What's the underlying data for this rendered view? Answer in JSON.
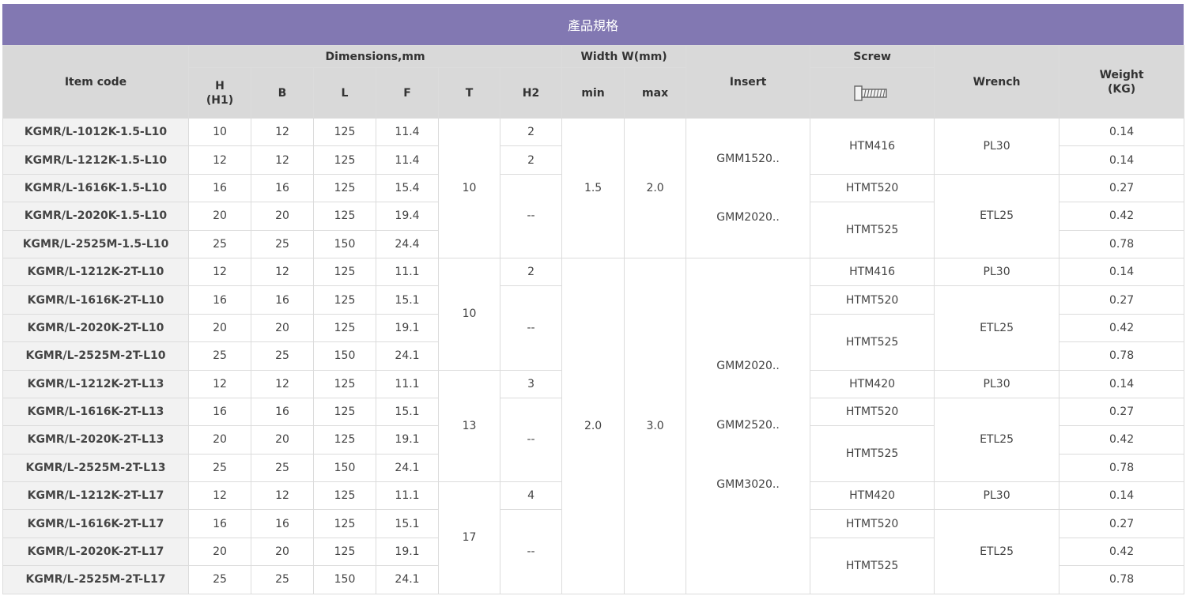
{
  "title": "產品規格",
  "headers": {
    "item_code": "Item code",
    "dimensions": "Dimensions,mm",
    "width": "Width W(mm)",
    "insert": "Insert",
    "screw": "Screw",
    "wrench": "Wrench",
    "weight_line1": "Weight",
    "weight_line2": "(KG)",
    "h_line1": "H",
    "h_line2": "(H1)",
    "b": "B",
    "l": "L",
    "f": "F",
    "t": "T",
    "h2": "H2",
    "min": "min",
    "max": "max",
    "screw_icon": "screw-icon"
  },
  "rows": [
    {
      "code": "KGMR/L-1012K-1.5-L10",
      "h": "10",
      "b": "12",
      "l": "125",
      "f": "11.4",
      "weight": "0.14"
    },
    {
      "code": "KGMR/L-1212K-1.5-L10",
      "h": "12",
      "b": "12",
      "l": "125",
      "f": "11.4",
      "weight": "0.14"
    },
    {
      "code": "KGMR/L-1616K-1.5-L10",
      "h": "16",
      "b": "16",
      "l": "125",
      "f": "15.4",
      "weight": "0.27"
    },
    {
      "code": "KGMR/L-2020K-1.5-L10",
      "h": "20",
      "b": "20",
      "l": "125",
      "f": "19.4",
      "weight": "0.42"
    },
    {
      "code": "KGMR/L-2525M-1.5-L10",
      "h": "25",
      "b": "25",
      "l": "150",
      "f": "24.4",
      "weight": "0.78"
    },
    {
      "code": "KGMR/L-1212K-2T-L10",
      "h": "12",
      "b": "12",
      "l": "125",
      "f": "11.1",
      "weight": "0.14"
    },
    {
      "code": "KGMR/L-1616K-2T-L10",
      "h": "16",
      "b": "16",
      "l": "125",
      "f": "15.1",
      "weight": "0.27"
    },
    {
      "code": "KGMR/L-2020K-2T-L10",
      "h": "20",
      "b": "20",
      "l": "125",
      "f": "19.1",
      "weight": "0.42"
    },
    {
      "code": "KGMR/L-2525M-2T-L10",
      "h": "25",
      "b": "25",
      "l": "150",
      "f": "24.1",
      "weight": "0.78"
    },
    {
      "code": "KGMR/L-1212K-2T-L13",
      "h": "12",
      "b": "12",
      "l": "125",
      "f": "11.1",
      "weight": "0.14"
    },
    {
      "code": "KGMR/L-1616K-2T-L13",
      "h": "16",
      "b": "16",
      "l": "125",
      "f": "15.1",
      "weight": "0.27"
    },
    {
      "code": "KGMR/L-2020K-2T-L13",
      "h": "20",
      "b": "20",
      "l": "125",
      "f": "19.1",
      "weight": "0.42"
    },
    {
      "code": "KGMR/L-2525M-2T-L13",
      "h": "25",
      "b": "25",
      "l": "150",
      "f": "24.1",
      "weight": "0.78"
    },
    {
      "code": "KGMR/L-1212K-2T-L17",
      "h": "12",
      "b": "12",
      "l": "125",
      "f": "11.1",
      "weight": "0.14"
    },
    {
      "code": "KGMR/L-1616K-2T-L17",
      "h": "16",
      "b": "16",
      "l": "125",
      "f": "15.1",
      "weight": "0.27"
    },
    {
      "code": "KGMR/L-2020K-2T-L17",
      "h": "20",
      "b": "20",
      "l": "125",
      "f": "19.1",
      "weight": "0.42"
    },
    {
      "code": "KGMR/L-2525M-2T-L17",
      "h": "25",
      "b": "25",
      "l": "150",
      "f": "24.1",
      "weight": "0.78"
    }
  ],
  "t_values": [
    "10",
    "10",
    "13",
    "17"
  ],
  "h2_values": [
    "2",
    "2",
    "--",
    "2",
    "--",
    "3",
    "--",
    "4",
    "--"
  ],
  "width_groups": [
    {
      "min": "1.5",
      "max": "2.0"
    },
    {
      "min": "2.0",
      "max": "3.0"
    }
  ],
  "insert_groups": [
    {
      "lines": [
        "GMM1520..",
        "GMM2020.."
      ]
    },
    {
      "lines": [
        "GMM2020..",
        "GMM2520..",
        "GMM3020.."
      ]
    }
  ],
  "screw_values": [
    "HTM416",
    "HTMT520",
    "HTMT525",
    "HTM416",
    "HTMT520",
    "HTMT525",
    "HTM420",
    "HTMT520",
    "HTMT525",
    "HTM420",
    "HTMT520",
    "HTMT525"
  ],
  "wrench_values": [
    "PL30",
    "ETL25",
    "PL30",
    "ETL25",
    "PL30",
    "ETL25",
    "PL30",
    "ETL25"
  ],
  "colors": {
    "title_bg": "#8278b2",
    "header_bg": "#d9d9d9",
    "code_bg": "#f2f2f2",
    "border": "#dcdcdc"
  }
}
